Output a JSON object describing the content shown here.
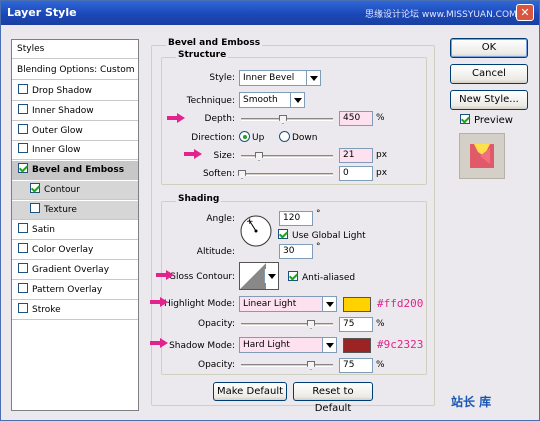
{
  "window": {
    "title": "Layer Style",
    "watermark": "思缘设计论坛  www.MISSYUAN.COM",
    "close_glyph": "✕"
  },
  "styles_list": {
    "items": [
      {
        "label": "Styles",
        "checkbox": false
      },
      {
        "label": "Blending Options: Custom",
        "checkbox": false
      },
      {
        "label": "Drop Shadow",
        "checkbox": true,
        "checked": false
      },
      {
        "label": "Inner Shadow",
        "checkbox": true,
        "checked": false
      },
      {
        "label": "Outer Glow",
        "checkbox": true,
        "checked": false
      },
      {
        "label": "Inner Glow",
        "checkbox": true,
        "checked": false
      },
      {
        "label": "Bevel and Emboss",
        "checkbox": true,
        "checked": true
      },
      {
        "label": "Contour",
        "checkbox": true,
        "checked": true
      },
      {
        "label": "Texture",
        "checkbox": true,
        "checked": false
      },
      {
        "label": "Satin",
        "checkbox": true,
        "checked": false
      },
      {
        "label": "Color Overlay",
        "checkbox": true,
        "checked": false
      },
      {
        "label": "Gradient Overlay",
        "checkbox": true,
        "checked": false
      },
      {
        "label": "Pattern Overlay",
        "checkbox": true,
        "checked": false
      },
      {
        "label": "Stroke",
        "checkbox": true,
        "checked": false
      }
    ]
  },
  "bevel": {
    "group_title": "Bevel and Emboss",
    "structure_title": "Structure",
    "style_label": "Style:",
    "style_value": "Inner Bevel",
    "technique_label": "Technique:",
    "technique_value": "Smooth",
    "depth_label": "Depth:",
    "depth_value": "450",
    "depth_unit": "%",
    "direction_label": "Direction:",
    "dir_up": "Up",
    "dir_down": "Down",
    "size_label": "Size:",
    "size_value": "21",
    "size_unit": "px",
    "soften_label": "Soften:",
    "soften_value": "0",
    "soften_unit": "px"
  },
  "shading": {
    "title": "Shading",
    "angle_label": "Angle:",
    "angle_value": "120",
    "angle_unit": "°",
    "global_light_label": "Use Global Light",
    "altitude_label": "Altitude:",
    "altitude_value": "30",
    "altitude_unit": "°",
    "gloss_label": "Gloss Contour:",
    "anti_aliased_label": "Anti-aliased",
    "highlight_label": "Highlight Mode:",
    "highlight_value": "Linear Light",
    "highlight_color": "#ffd200",
    "highlight_hex": "#ffd200",
    "h_opacity_label": "Opacity:",
    "h_opacity_value": "75",
    "h_opacity_unit": "%",
    "shadow_label": "Shadow Mode:",
    "shadow_value": "Hard Light",
    "shadow_color": "#9c2323",
    "shadow_hex": "#9c2323",
    "s_opacity_label": "Opacity:",
    "s_opacity_value": "75",
    "s_opacity_unit": "%"
  },
  "buttons": {
    "make_default": "Make Default",
    "reset_default": "Reset to Default",
    "ok": "OK",
    "cancel": "Cancel",
    "new_style": "New Style...",
    "preview": "Preview"
  },
  "logo": {
    "text": "站长  库"
  },
  "colors": {
    "pink_arrow": "#e0248c",
    "title_bar": "#1b48b8"
  }
}
